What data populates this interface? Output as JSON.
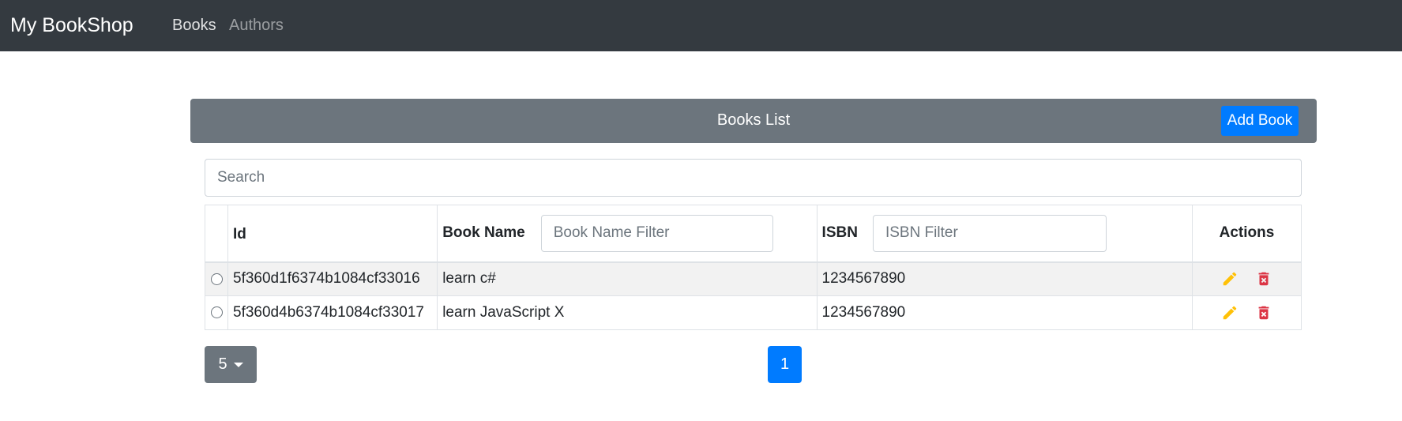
{
  "navbar": {
    "brand": "My BookShop",
    "links": [
      {
        "label": "Books",
        "active": true
      },
      {
        "label": "Authors",
        "active": false
      }
    ]
  },
  "list_header": {
    "title": "Books List",
    "add_button_label": "Add Book"
  },
  "search": {
    "placeholder": "Search",
    "value": ""
  },
  "table": {
    "columns": {
      "id": "Id",
      "book_name": "Book Name",
      "book_name_filter_placeholder": "Book Name Filter",
      "isbn": "ISBN",
      "isbn_filter_placeholder": "ISBN Filter",
      "actions": "Actions"
    },
    "rows": [
      {
        "id": "5f360d1f6374b1084cf33016",
        "book_name": "learn c#",
        "isbn": "1234567890"
      },
      {
        "id": "5f360d4b6374b1084cf33017",
        "book_name": "learn JavaScript X",
        "isbn": "1234567890"
      }
    ]
  },
  "pagination": {
    "page_size": "5",
    "pages": [
      "1"
    ],
    "current_page": "1"
  },
  "colors": {
    "navbar_bg": "#343a40",
    "header_bg": "#6c757d",
    "primary": "#007bff",
    "edit_icon": "#ffc107",
    "delete_icon": "#dc3545"
  },
  "icons": {
    "edit": "pencil-icon",
    "delete": "trash-icon",
    "dropdown": "caret-down-icon"
  }
}
